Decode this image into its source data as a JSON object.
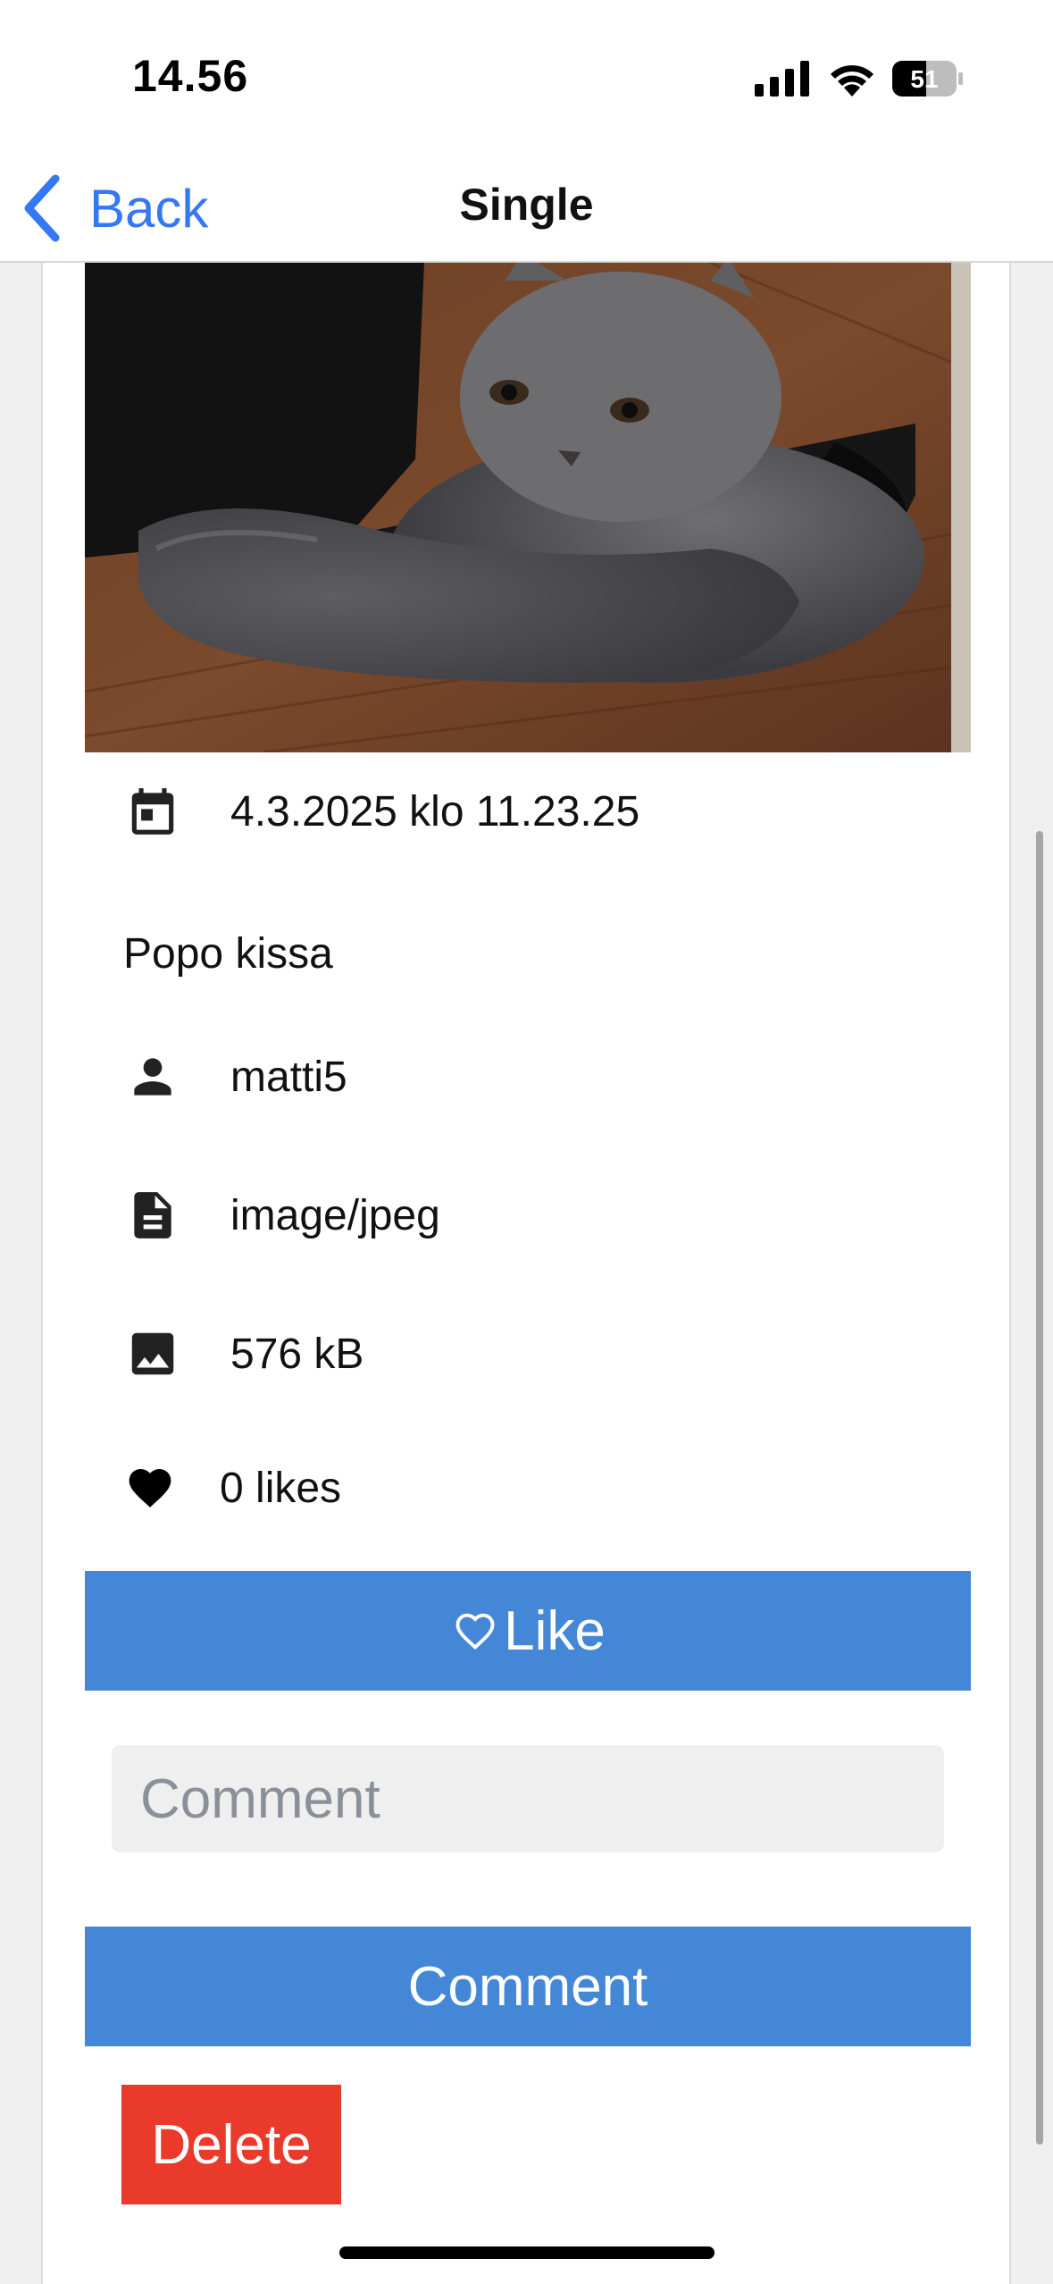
{
  "status_bar": {
    "time": "14.56",
    "battery_level": "51",
    "icons": [
      "signal-icon",
      "wifi-icon",
      "battery-icon"
    ]
  },
  "nav": {
    "back_label": "Back",
    "title": "Single"
  },
  "media": {
    "image_icon": "cat-photo"
  },
  "details": {
    "date": "4.3.2025 klo 11.23.25",
    "description": "Popo kissa",
    "username": "matti5",
    "media_type": "image/jpeg",
    "file_size": "576 kB",
    "likes": "0 likes"
  },
  "actions": {
    "like_label": "Like",
    "comment_placeholder": "Comment",
    "comment_value": "",
    "comment_button_label": "Comment",
    "delete_label": "Delete"
  },
  "colors": {
    "accent": "#3478f6",
    "primary_button": "#4487d6",
    "danger_button": "#e93a2b"
  }
}
